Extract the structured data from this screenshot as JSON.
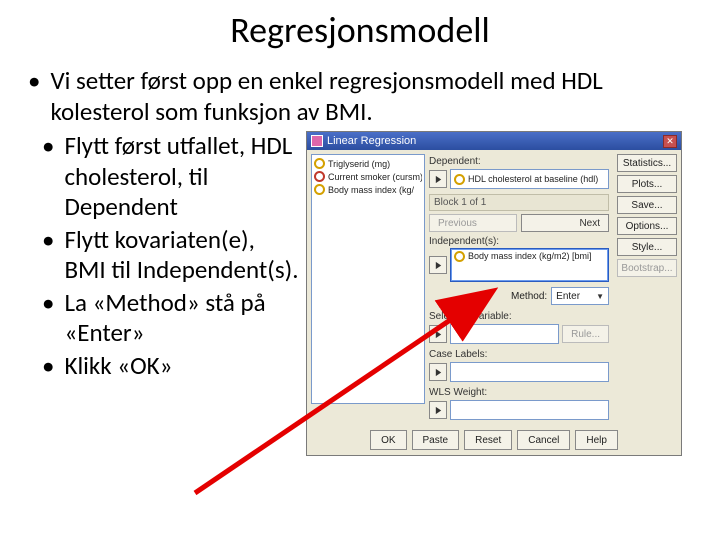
{
  "title": "Regresjonsmodell",
  "bullets": {
    "main": "Vi setter først opp en enkel regresjonsmodell med HDL kolesterol som funksjon av BMI.",
    "sub1": "Flytt først utfallet, HDL cholesterol, til Dependent",
    "sub2": "Flytt kovariaten(e), BMI til Independent(s).",
    "sub3": "La «Method» stå på «Enter»",
    "sub4": "Klikk «OK»"
  },
  "dialog": {
    "title": "Linear Regression",
    "vars": {
      "v1": "Triglyserid (mg)",
      "v2": "Current smoker (cursm)",
      "v3": "Body mass index (kg/"
    },
    "labels": {
      "dependent": "Dependent:",
      "block": "Block 1 of 1",
      "previous": "Previous",
      "next": "Next",
      "independent": "Independent(s):",
      "method": "Method:",
      "selection": "Selection Variable:",
      "rule": "Rule...",
      "caselabels": "Case Labels:",
      "wls": "WLS Weight:"
    },
    "values": {
      "dependent": "HDL cholesterol at baseline (hdl)",
      "independent": "Body mass index (kg/m2) [bmi]",
      "method": "Enter"
    },
    "sidebtn": {
      "stats": "Statistics...",
      "plots": "Plots...",
      "save": "Save...",
      "options": "Options...",
      "style": "Style...",
      "bootstrap": "Bootstrap..."
    },
    "footer": {
      "ok": "OK",
      "paste": "Paste",
      "reset": "Reset",
      "cancel": "Cancel",
      "help": "Help"
    }
  }
}
